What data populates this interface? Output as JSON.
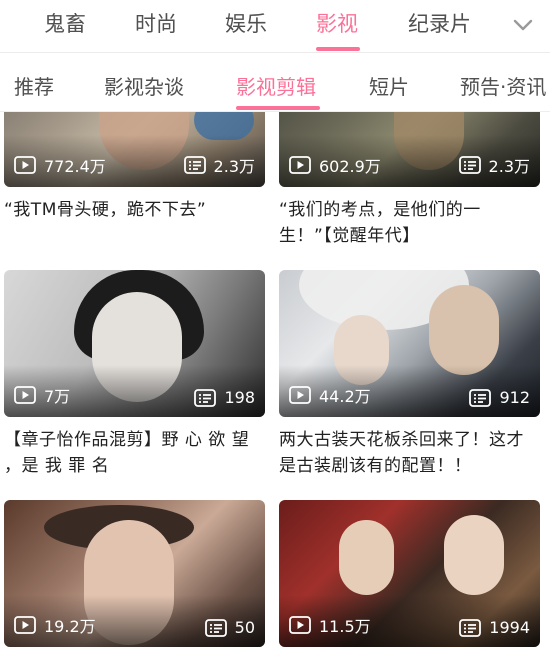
{
  "top_tabs": [
    {
      "label": "鬼畜"
    },
    {
      "label": "时尚"
    },
    {
      "label": "娱乐"
    },
    {
      "label": "影视",
      "active": true
    },
    {
      "label": "纪录片"
    }
  ],
  "sub_tabs": [
    {
      "label": "推荐"
    },
    {
      "label": "影视杂谈"
    },
    {
      "label": "影视剪辑",
      "active": true
    },
    {
      "label": "短片"
    },
    {
      "label": "预告·资讯"
    }
  ],
  "colors": {
    "accent": "#fb7299",
    "text": "#212121",
    "tab_text": "#505050"
  },
  "icons": {
    "play_count": "play-count-icon",
    "danmaku": "danmaku-icon",
    "expand": "chevron-down-icon"
  },
  "videos": [
    {
      "views": "772.4万",
      "danmaku": "2.3万",
      "title": "“我TM骨头硬，跪不下去”"
    },
    {
      "views": "602.9万",
      "danmaku": "2.3万",
      "title": "“我们的考点，是他们的一生！”【觉醒年代】"
    },
    {
      "views": "7万",
      "danmaku": "198",
      "title": "【章子怡作品混剪】野 心 欲 望 ，是 我 罪 名"
    },
    {
      "views": "44.2万",
      "danmaku": "912",
      "title": "两大古装天花板杀回来了！这才是古装剧该有的配置！！"
    },
    {
      "views": "19.2万",
      "danmaku": "50",
      "title": ""
    },
    {
      "views": "11.5万",
      "danmaku": "1994",
      "title": ""
    }
  ]
}
